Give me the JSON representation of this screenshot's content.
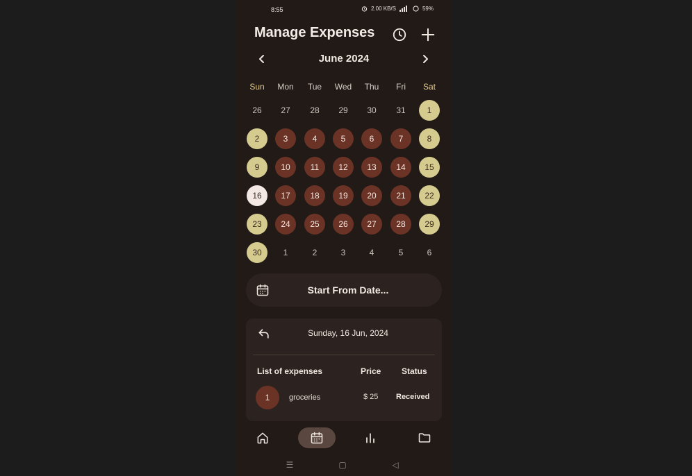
{
  "status_bar": {
    "time": "8:55",
    "net_speed": "2.00 KB/S",
    "battery": "59%"
  },
  "header": {
    "title": "Manage Expenses",
    "history_icon": "clock-icon",
    "add_icon": "plus-icon"
  },
  "calendar": {
    "month_label": "June 2024",
    "weekdays": [
      "Sun",
      "Mon",
      "Tue",
      "Wed",
      "Thu",
      "Fri",
      "Sat"
    ],
    "weeks": [
      [
        "26",
        "27",
        "28",
        "29",
        "30",
        "31",
        "1"
      ],
      [
        "2",
        "3",
        "4",
        "5",
        "6",
        "7",
        "8"
      ],
      [
        "9",
        "10",
        "11",
        "12",
        "13",
        "14",
        "15"
      ],
      [
        "16",
        "17",
        "18",
        "19",
        "20",
        "21",
        "22"
      ],
      [
        "23",
        "24",
        "25",
        "26",
        "27",
        "28",
        "29"
      ],
      [
        "30",
        "1",
        "2",
        "3",
        "4",
        "5",
        "6"
      ]
    ],
    "selected_day": "16",
    "colors": {
      "weekday_fill": "#6b3325",
      "weekend_fill": "#d6cb8f",
      "today_fill": "#f3e8e4"
    }
  },
  "start_from": {
    "label": "Start From Date..."
  },
  "detail": {
    "date_label": "Sunday, 16 Jun, 2024",
    "columns": {
      "list": "List of expenses",
      "price": "Price",
      "status": "Status"
    },
    "expenses": [
      {
        "index": "1",
        "name": "groceries",
        "price": "$  25",
        "status": "Received"
      }
    ]
  },
  "bottom_nav": {
    "items": [
      "home-icon",
      "calendar-icon",
      "bar-chart-icon",
      "folder-icon"
    ],
    "active": "calendar-icon"
  },
  "system_nav": {
    "menu": "☰",
    "home": "▢",
    "back": "◁"
  }
}
